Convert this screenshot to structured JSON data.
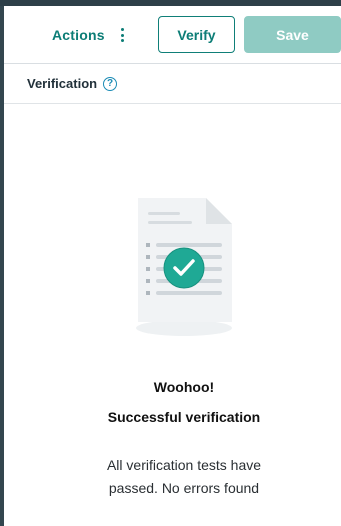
{
  "toolbar": {
    "actions_label": "Actions",
    "verify_label": "Verify",
    "save_label": "Save"
  },
  "section": {
    "title": "Verification",
    "help_glyph": "?"
  },
  "result": {
    "headline": "Woohoo!",
    "subheadline": "Successful verification",
    "body_line1": "All verification tests have",
    "body_line2": "passed. No errors found"
  },
  "icons": {
    "kebab": "vertical-dots-icon",
    "help": "question-circle-icon",
    "illustration": "document-check-icon"
  },
  "colors": {
    "accent": "#0c7d76",
    "save_disabled": "#8fcbc3",
    "success_check": "#1fa995",
    "help_blue": "#1b8bb5"
  }
}
